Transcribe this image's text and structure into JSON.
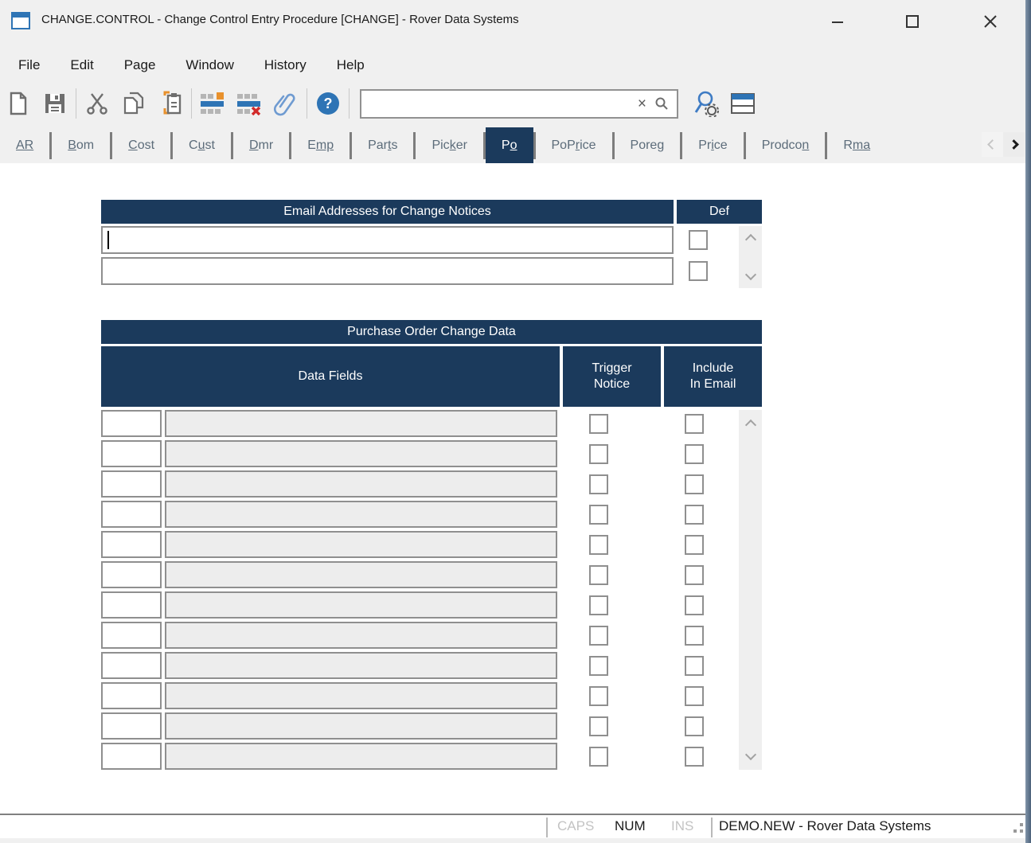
{
  "window": {
    "title": "CHANGE.CONTROL - Change Control Entry Procedure [CHANGE] - Rover Data Systems"
  },
  "menu": {
    "items": [
      "File",
      "Edit",
      "Page",
      "Window",
      "History",
      "Help"
    ]
  },
  "toolbar": {
    "icons": [
      "new-document",
      "save",
      "cut",
      "copy",
      "paste",
      "insert-row",
      "delete-row",
      "attachment",
      "help"
    ],
    "search": {
      "value": "",
      "placeholder": "",
      "clear_glyph": "×"
    },
    "right_icons": [
      "advanced-search",
      "window-layout"
    ]
  },
  "tabs": {
    "items": [
      {
        "label": "AR",
        "pre": "",
        "underline": "AR",
        "post": "",
        "active": false
      },
      {
        "label": "Bom",
        "pre": "",
        "underline": "B",
        "post": "om",
        "active": false
      },
      {
        "label": "Cost",
        "pre": "",
        "underline": "C",
        "post": "ost",
        "active": false
      },
      {
        "label": "Cust",
        "pre": "C",
        "underline": "u",
        "post": "st",
        "active": false
      },
      {
        "label": "Dmr",
        "pre": "",
        "underline": "D",
        "post": "mr",
        "active": false
      },
      {
        "label": "Emp",
        "pre": "E",
        "underline": "mp",
        "post": "",
        "active": false
      },
      {
        "label": "Parts",
        "pre": "Par",
        "underline": "t",
        "post": "s",
        "active": false
      },
      {
        "label": "Picker",
        "pre": "Pic",
        "underline": "k",
        "post": "er",
        "active": false
      },
      {
        "label": "Po",
        "pre": "P",
        "underline": "o",
        "post": "",
        "active": true
      },
      {
        "label": "PoPrice",
        "pre": "PoP",
        "underline": "r",
        "post": "ice",
        "active": false
      },
      {
        "label": "Poreg",
        "pre": "Pore",
        "underline": "g",
        "post": "",
        "active": false
      },
      {
        "label": "Price",
        "pre": "Pr",
        "underline": "i",
        "post": "ce",
        "active": false
      },
      {
        "label": "Prodcon",
        "pre": "Prodco",
        "underline": "n",
        "post": "",
        "active": false
      },
      {
        "label": "Rma",
        "pre": "R",
        "underline": "ma",
        "post": "",
        "active": false
      }
    ]
  },
  "email_table": {
    "header": "Email Addresses for Change Notices",
    "def_header": "Def",
    "rows": [
      {
        "value": "",
        "def_checked": false
      },
      {
        "value": "",
        "def_checked": false
      }
    ]
  },
  "po_table": {
    "title": "Purchase Order Change Data",
    "columns": {
      "data_fields": "Data Fields",
      "trigger_line1": "Trigger",
      "trigger_line2": "Notice",
      "include_line1": "Include",
      "include_line2": "In Email"
    },
    "rows": [
      {
        "code": "",
        "field": "",
        "trigger": false,
        "include": false
      },
      {
        "code": "",
        "field": "",
        "trigger": false,
        "include": false
      },
      {
        "code": "",
        "field": "",
        "trigger": false,
        "include": false
      },
      {
        "code": "",
        "field": "",
        "trigger": false,
        "include": false
      },
      {
        "code": "",
        "field": "",
        "trigger": false,
        "include": false
      },
      {
        "code": "",
        "field": "",
        "trigger": false,
        "include": false
      },
      {
        "code": "",
        "field": "",
        "trigger": false,
        "include": false
      },
      {
        "code": "",
        "field": "",
        "trigger": false,
        "include": false
      },
      {
        "code": "",
        "field": "",
        "trigger": false,
        "include": false
      },
      {
        "code": "",
        "field": "",
        "trigger": false,
        "include": false
      },
      {
        "code": "",
        "field": "",
        "trigger": false,
        "include": false
      },
      {
        "code": "",
        "field": "",
        "trigger": false,
        "include": false
      }
    ]
  },
  "status_bar": {
    "caps": "CAPS",
    "num": "NUM",
    "ins": "INS",
    "caps_active": false,
    "num_active": true,
    "ins_active": false,
    "session": "DEMO.NEW - Rover Data Systems"
  },
  "colors": {
    "navy": "#1b3a5c",
    "accent_blue": "#2e74b5",
    "chrome_gray": "#f0f0f0",
    "disabled_field": "#ededed",
    "border_gray": "#8f8f8f"
  }
}
